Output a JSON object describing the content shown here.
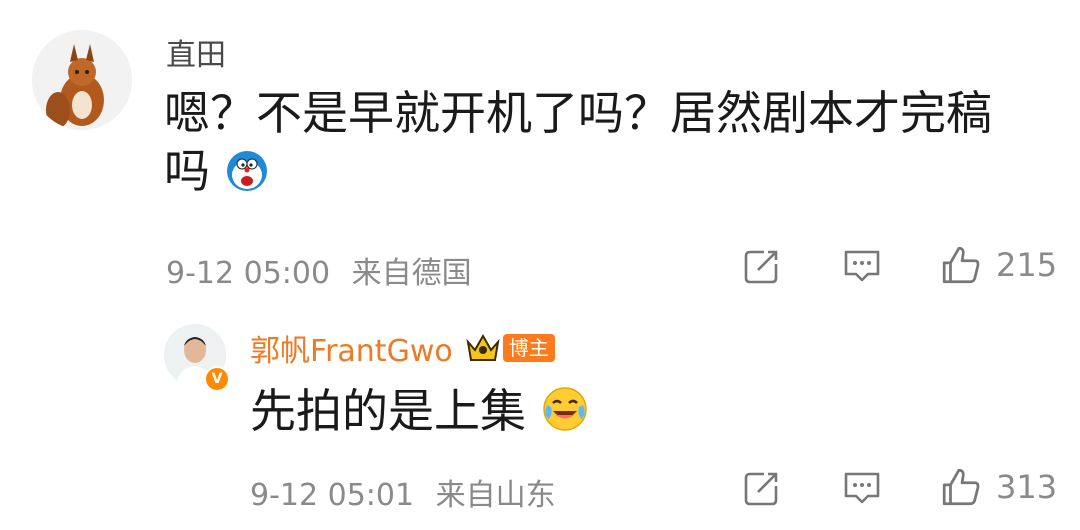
{
  "comment": {
    "username": "直田",
    "text": "嗯？不是早就开机了吗？居然剧本才完稿吗",
    "emoji": "doraemon-emoji",
    "time": "9-12 05:00",
    "location": "来自德国",
    "likes": "215"
  },
  "reply": {
    "username": "郭帆FrantGwo",
    "badge": "博主",
    "text": "先拍的是上集",
    "emoji": "laughing-tears-emoji",
    "time": "9-12 05:01",
    "location": "来自山东",
    "likes": "313"
  },
  "icons": {
    "share": "share-icon",
    "comment": "comment-icon",
    "like": "like-icon"
  },
  "colors": {
    "accent": "#EE7A25",
    "meta": "#8A8A8A"
  }
}
